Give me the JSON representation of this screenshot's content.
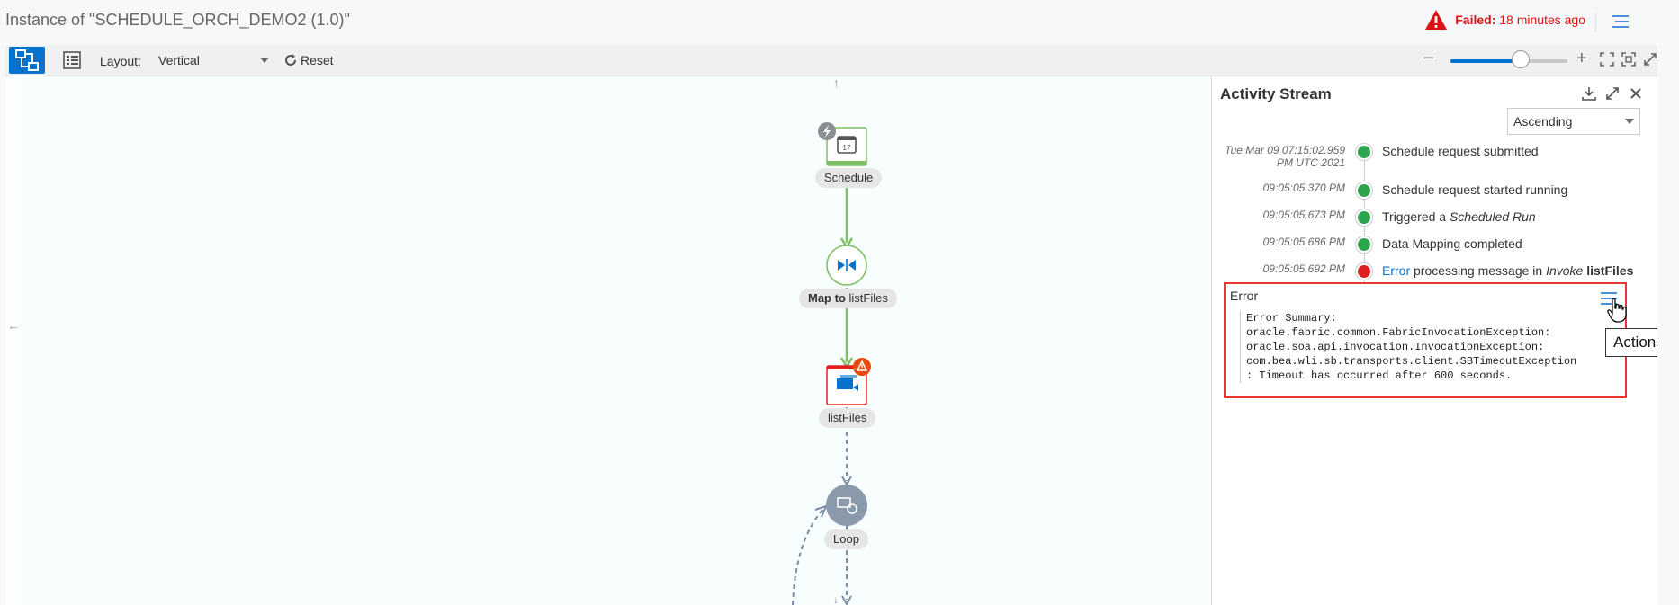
{
  "header": {
    "title": "Instance of \"SCHEDULE_ORCH_DEMO2 (1.0)\"",
    "status_label": "Failed:",
    "status_time": "18 minutes ago",
    "status_color": "#dd1111"
  },
  "toolbar": {
    "layout_label": "Layout:",
    "layout_value": "Vertical",
    "reset_label": "Reset",
    "zoom_level": 0.6,
    "accent": "#0572ce"
  },
  "canvas": {
    "nodes": [
      {
        "name": "schedule",
        "label": "Schedule",
        "icon": "calendar-icon",
        "badge": "lightning-icon",
        "calendar_day": "17"
      },
      {
        "name": "map",
        "label_bold": "Map to",
        "label_rest": " listFiles",
        "icon": "map-arrows-icon"
      },
      {
        "name": "listfiles",
        "label": "listFiles",
        "icon": "invoke-icon",
        "badge": "warning-icon"
      },
      {
        "name": "loop",
        "label": "Loop",
        "icon": "loop-icon"
      }
    ]
  },
  "activity": {
    "title": "Activity Stream",
    "sort_value": "Ascending",
    "events": [
      {
        "ts": "Tue Mar 09 07:15:02.959",
        "ts2": "PM UTC 2021",
        "status": "success",
        "text": "Schedule request submitted"
      },
      {
        "ts": "09:05:05.370 PM",
        "status": "success",
        "text": "Schedule request started running"
      },
      {
        "ts": "09:05:05.673 PM",
        "status": "success",
        "text_prefix": "Triggered a ",
        "text_em": "Scheduled Run"
      },
      {
        "ts": "09:05:05.686 PM",
        "status": "success",
        "text": "Data Mapping completed"
      },
      {
        "ts": "09:05:05.692 PM",
        "status": "error",
        "link": "Error",
        "text_mid": " processing message in ",
        "text_em": "Invoke",
        "text_bold": "listFiles"
      }
    ],
    "success_color": "#2ea44f",
    "error_color": "#e02020",
    "error_box": {
      "title": "Error",
      "body": "Error Summary:\noracle.fabric.common.FabricInvocationException:\noracle.soa.api.invocation.InvocationException:\ncom.bea.wli.sb.transports.client.SBTimeoutException\n: Timeout has occurred after 600 seconds.",
      "tooltip": "Actions"
    }
  }
}
